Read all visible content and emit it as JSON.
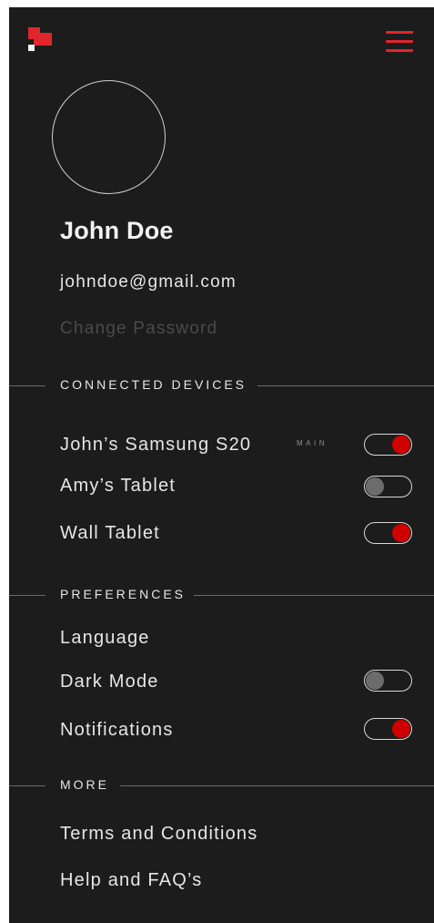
{
  "brand": {
    "logo_icon": "logo-icon",
    "accent": "#e0262c"
  },
  "header": {
    "menu_icon": "hamburger-menu-icon"
  },
  "profile": {
    "name": "John Doe",
    "email": "johndoe@gmail.com",
    "change_password": "Change Password"
  },
  "connected_devices": {
    "title": "CONNECTED DEVICES",
    "items": [
      {
        "label": "John’s Samsung S20",
        "badge": "MAIN",
        "enabled": true
      },
      {
        "label": "Amy’s Tablet",
        "enabled": false
      },
      {
        "label": "Wall Tablet",
        "enabled": true
      }
    ]
  },
  "preferences": {
    "title": "PREFERENCES",
    "language": "Language",
    "dark_mode": {
      "label": "Dark Mode",
      "enabled": false
    },
    "notifications": {
      "label": "Notifications",
      "enabled": true
    }
  },
  "more": {
    "title": "MORE",
    "terms": "Terms and Conditions",
    "help": "Help and FAQ’s"
  },
  "colors": {
    "background": "#1c1c1c",
    "toggle_on": "#d00000",
    "toggle_off": "#6c6c6c",
    "muted_text": "#4a4a4a"
  }
}
